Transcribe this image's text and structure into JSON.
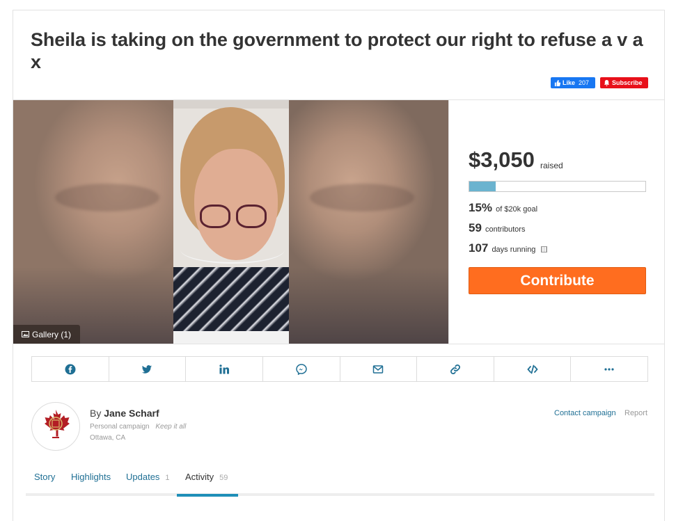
{
  "campaign": {
    "title": "Sheila is taking on the government to protect our right to refuse a v a x"
  },
  "social": {
    "like_label": "Like",
    "like_count": "207",
    "subscribe_label": "Subscribe"
  },
  "media": {
    "gallery_label": "Gallery (1)"
  },
  "funding": {
    "amount": "$3,050",
    "amount_label": "raised",
    "progress_fraction": 0.15,
    "percent": "15%",
    "percent_label": "of $20k goal",
    "contributors": "59",
    "contributors_label": "contributors",
    "days": "107",
    "days_label": "days running",
    "contribute_label": "Contribute"
  },
  "share": {
    "buttons": [
      "facebook-icon",
      "twitter-icon",
      "linkedin-icon",
      "messenger-icon",
      "email-icon",
      "link-icon",
      "embed-icon",
      "more-icon"
    ]
  },
  "organizer": {
    "by_prefix": "By",
    "name": "Jane Scharf",
    "campaign_type": "Personal campaign",
    "tagline": "Keep it all",
    "location": "Ottawa, CA",
    "contact_label": "Contact campaign",
    "report_label": "Report"
  },
  "tabs": [
    {
      "label": "Story",
      "count": ""
    },
    {
      "label": "Highlights",
      "count": ""
    },
    {
      "label": "Updates",
      "count": "1"
    },
    {
      "label": "Activity",
      "count": "59"
    }
  ],
  "colors": {
    "accent": "#ff6d1f",
    "link": "#1f6f94",
    "progress": "#6bb3cf",
    "facebook": "#1877f2",
    "subscribe": "#e8101a"
  }
}
